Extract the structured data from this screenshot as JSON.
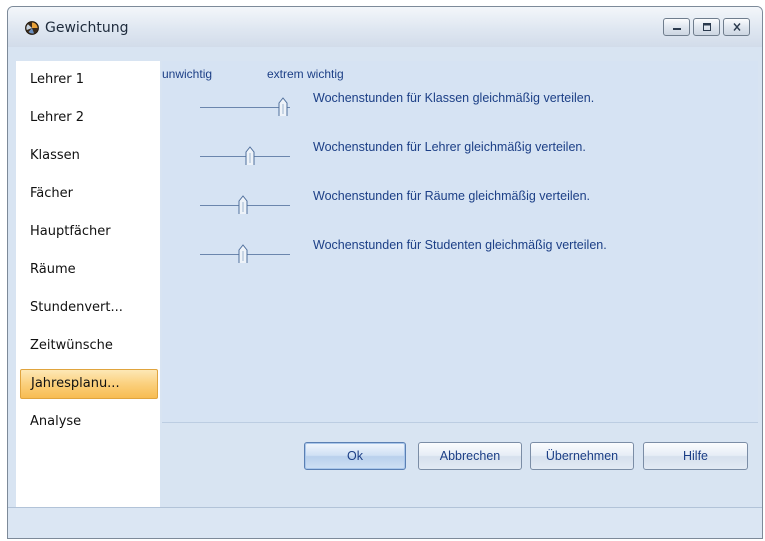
{
  "window": {
    "title": "Gewichtung",
    "app_icon": "app-globe-icon",
    "caption_buttons": [
      "minimize-icon",
      "maximize-icon",
      "close-icon"
    ]
  },
  "nav": {
    "items": [
      {
        "label": "Lehrer 1"
      },
      {
        "label": "Lehrer 2"
      },
      {
        "label": "Klassen"
      },
      {
        "label": "Fächer"
      },
      {
        "label": "Hauptfächer"
      },
      {
        "label": "Räume"
      },
      {
        "label": "Stundenvert..."
      },
      {
        "label": "Zeitwünsche"
      },
      {
        "label": "Jahresplanu..."
      },
      {
        "label": "Analyse"
      }
    ],
    "selected_index": 8,
    "selected_color": "#f7bc52"
  },
  "scale": {
    "low_label": "unwichtig",
    "high_label": "extrem wichtig"
  },
  "weights": [
    {
      "label": "Wochenstunden für Klassen gleichmäßig verteilen.",
      "level": 1.0
    },
    {
      "label": "Wochenstunden für Lehrer gleichmäßig verteilen.",
      "level": 0.5
    },
    {
      "label": "Wochenstunden für Räume gleichmäßig verteilen.",
      "level": 0.4
    },
    {
      "label": "Wochenstunden für Studenten gleichmäßig verteilen.",
      "level": 0.4
    }
  ],
  "buttons": {
    "ok": "Ok",
    "cancel": "Abbrechen",
    "apply": "Übernehmen",
    "help": "Hilfe"
  },
  "colors": {
    "label_text": "#1c3f86",
    "panel_background": "#d6e3f3"
  }
}
